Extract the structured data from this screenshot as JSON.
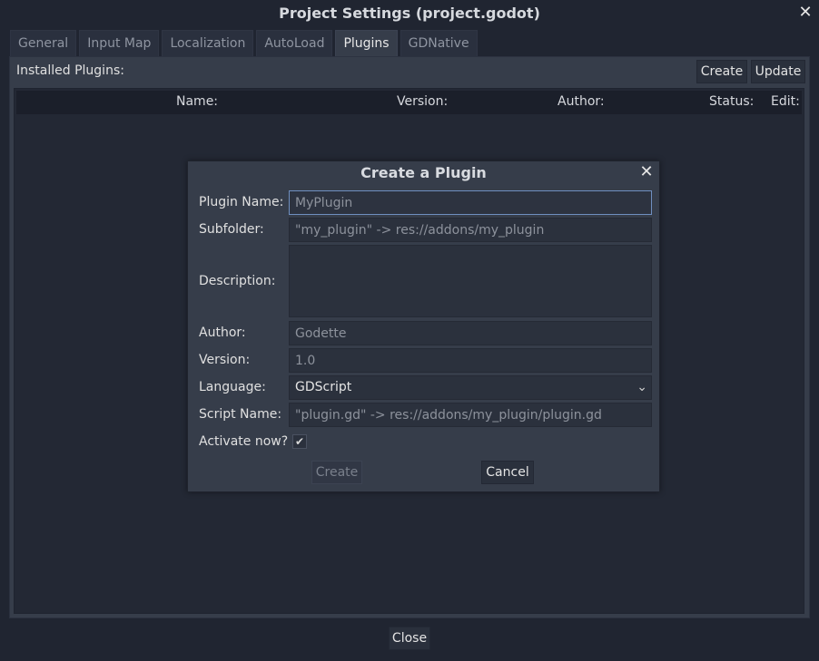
{
  "window": {
    "title": "Project Settings (project.godot)",
    "close_glyph": "✕"
  },
  "tabs": [
    {
      "label": "General"
    },
    {
      "label": "Input Map"
    },
    {
      "label": "Localization"
    },
    {
      "label": "AutoLoad"
    },
    {
      "label": "Plugins",
      "active": true
    },
    {
      "label": "GDNative"
    }
  ],
  "plugins": {
    "installed_label": "Installed Plugins:",
    "create_label": "Create",
    "update_label": "Update",
    "columns": [
      "Name:",
      "Version:",
      "Author:",
      "Status:",
      "Edit:"
    ]
  },
  "dialog": {
    "title": "Create a Plugin",
    "close_glyph": "✕",
    "plugin_name": {
      "label": "Plugin Name:",
      "value": "",
      "placeholder": "MyPlugin"
    },
    "subfolder": {
      "label": "Subfolder:",
      "value": "",
      "placeholder": "\"my_plugin\" -> res://addons/my_plugin"
    },
    "description": {
      "label": "Description:",
      "value": ""
    },
    "author": {
      "label": "Author:",
      "value": "",
      "placeholder": "Godette"
    },
    "version": {
      "label": "Version:",
      "value": "",
      "placeholder": "1.0"
    },
    "language": {
      "label": "Language:",
      "selected": "GDScript",
      "arrow": "⌄"
    },
    "script_name": {
      "label": "Script Name:",
      "value": "",
      "placeholder": "\"plugin.gd\" -> res://addons/my_plugin/plugin.gd"
    },
    "activate": {
      "label": "Activate now?",
      "checked": true,
      "check_glyph": "✔"
    },
    "create_label": "Create",
    "cancel_label": "Cancel"
  },
  "footer": {
    "close_label": "Close"
  }
}
